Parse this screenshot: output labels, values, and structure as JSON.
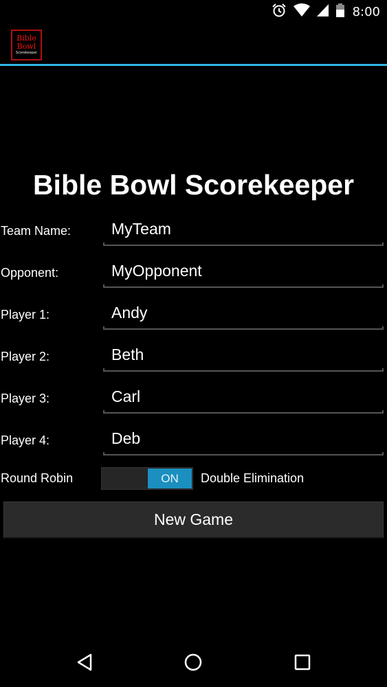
{
  "status_bar": {
    "time": "8:00",
    "icons": [
      "alarm-icon",
      "wifi-icon",
      "signal-icon",
      "battery-icon"
    ]
  },
  "app_bar": {
    "logo_line1": "Bible",
    "logo_line2": "Bowl",
    "logo_line3": "Scorekeeper",
    "accent_color": "#33b5e5"
  },
  "title": "Bible Bowl Scorekeeper",
  "form": {
    "rows": [
      {
        "label": "Team Name:",
        "value": "MyTeam"
      },
      {
        "label": "Opponent:",
        "value": "MyOpponent"
      },
      {
        "label": "Player 1:",
        "value": "Andy"
      },
      {
        "label": "Player 2:",
        "value": "Beth"
      },
      {
        "label": "Player 3:",
        "value": "Carl"
      },
      {
        "label": "Player 4:",
        "value": "Deb"
      }
    ]
  },
  "mode_toggle": {
    "left_label": "Round Robin",
    "state_text": "ON",
    "right_label": "Double Elimination",
    "active_color": "#1b8fbf"
  },
  "new_game_button": "New Game",
  "nav_bar": {
    "buttons": [
      "back-icon",
      "home-icon",
      "recents-icon"
    ]
  }
}
